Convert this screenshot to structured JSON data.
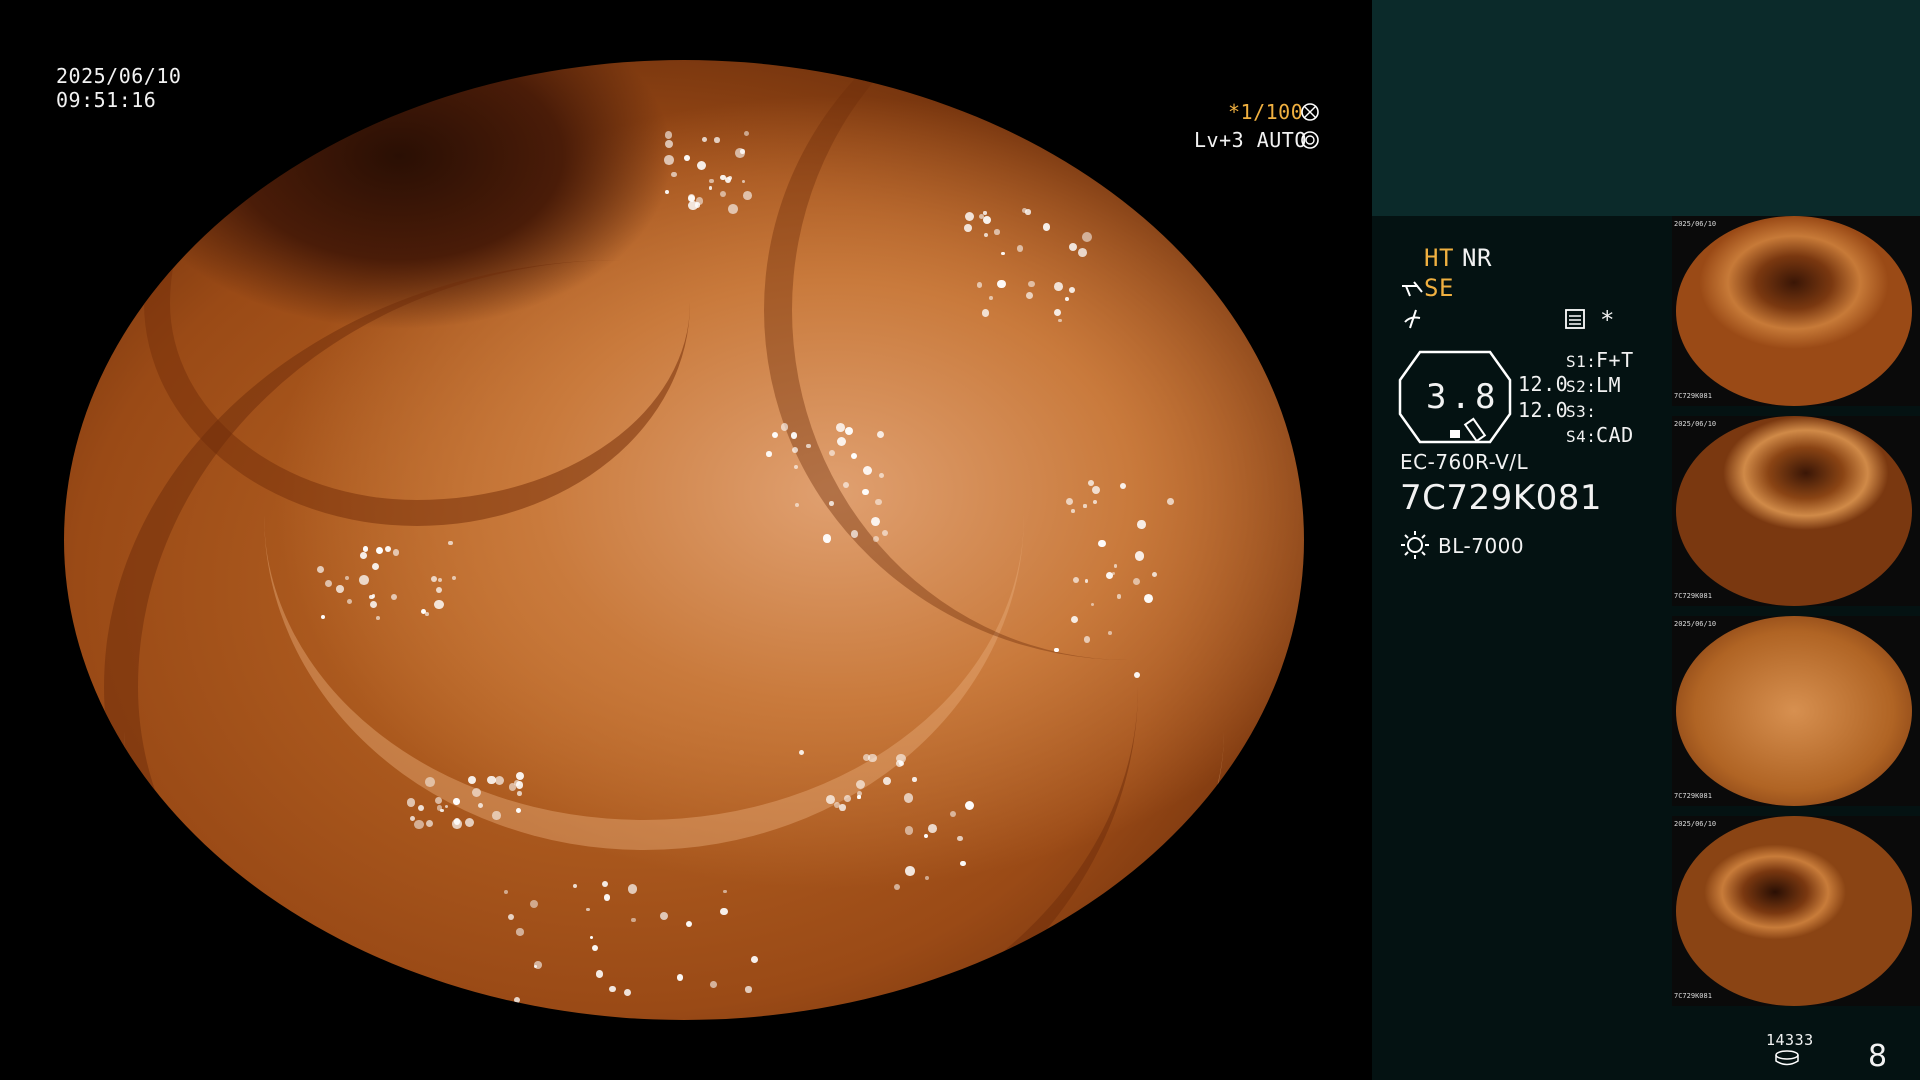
{
  "datetime": {
    "date": "2025/06/10",
    "time": "09:51:16"
  },
  "shutter": {
    "value": "*1/100"
  },
  "light_level": {
    "value": "Lv+3 AUTO"
  },
  "enhancements": {
    "ht": "HT",
    "nr": "NR",
    "se": "SE"
  },
  "asterisk": "*",
  "magnification": {
    "value": "3.8",
    "top": "12.0",
    "bottom": "12.0"
  },
  "switches": [
    {
      "label": "S1:",
      "value": "F+T"
    },
    {
      "label": "S2:",
      "value": "LM"
    },
    {
      "label": "S3:",
      "value": ""
    },
    {
      "label": "S4:",
      "value": "CAD"
    }
  ],
  "scope": {
    "model": "EC-760R-V/L",
    "serial": "7C729K081"
  },
  "light_source": "BL-7000",
  "storage": {
    "count": "14333"
  },
  "image_count": "8",
  "thumbnails": [
    {
      "date": "2025/06/10",
      "id": "7C729K081"
    },
    {
      "date": "2025/06/10",
      "id": "7C729K081"
    },
    {
      "date": "2025/06/10",
      "id": "7C729K081"
    },
    {
      "date": "2025/06/10",
      "id": "7C729K081"
    }
  ],
  "colors": {
    "accent": "#f0b040",
    "sidebar": "#041212",
    "sidebar_top": "#0b2a2a"
  }
}
